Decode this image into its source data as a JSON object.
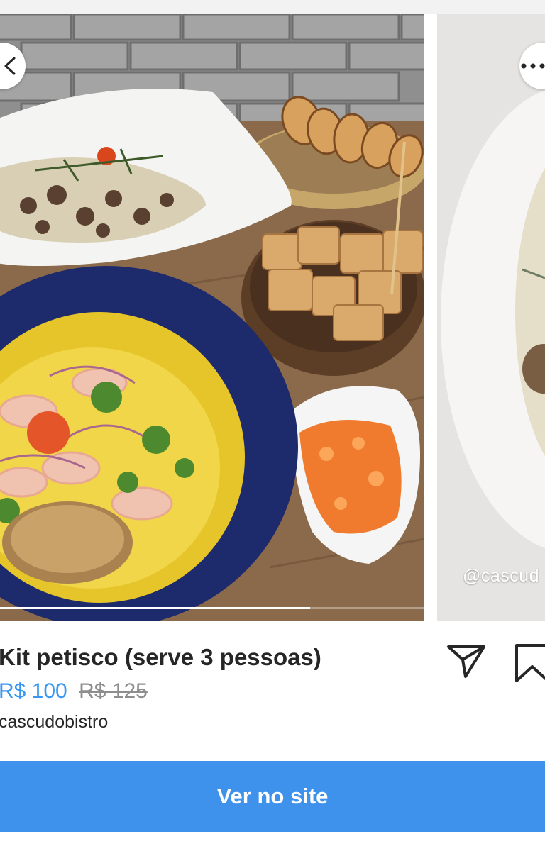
{
  "product": {
    "title": "Kit petisco (serve 3 pessoas)",
    "price_current": "R$ 100",
    "price_original": "R$ 125",
    "seller": "cascudobistro"
  },
  "carousel": {
    "watermark": "@cascud",
    "progress": 0.73
  },
  "actions": {
    "cta_label": "Ver no site",
    "back_icon": "chevron-left-icon",
    "more_icon": "more-horizontal-icon",
    "share_icon": "paper-plane-icon",
    "save_icon": "bookmark-icon"
  },
  "colors": {
    "accent": "#3897f0",
    "cta_background": "#3f92ec",
    "text": "#262626",
    "muted": "#8e8e8e"
  }
}
